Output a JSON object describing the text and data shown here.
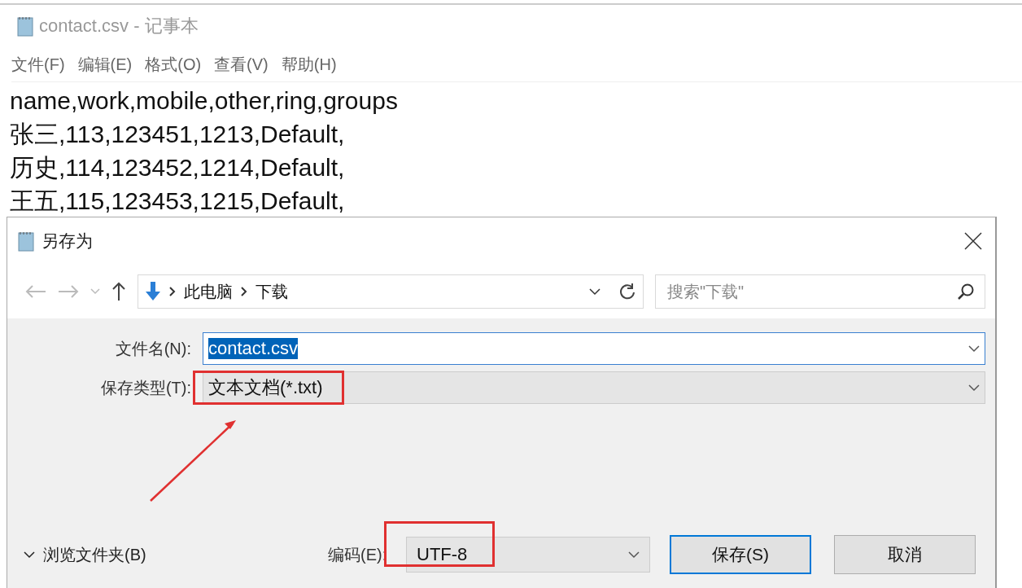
{
  "notepad": {
    "title": "contact.csv - 记事本",
    "menu": [
      "文件(F)",
      "编辑(E)",
      "格式(O)",
      "查看(V)",
      "帮助(H)"
    ],
    "lines": [
      "name,work,mobile,other,ring,groups",
      "张三,113,123451,1213,Default,",
      "历史,114,123452,1214,Default,",
      "王五,115,123453,1215,Default,"
    ]
  },
  "dialog": {
    "title": "另存为",
    "breadcrumb": [
      "此电脑",
      "下载"
    ],
    "search": {
      "placeholder": "搜索\"下载\""
    },
    "filename": {
      "label": "文件名(N):",
      "value": "contact.csv",
      "selected": true
    },
    "filetype": {
      "label": "保存类型(T):",
      "value": "文本文档(*.txt)"
    },
    "browse": {
      "label": "浏览文件夹(B)"
    },
    "encoding": {
      "label": "编码(E):",
      "value": "UTF-8"
    },
    "buttons": [
      {
        "label": "保存(S)",
        "kind": "primary"
      },
      {
        "label": "取消",
        "kind": "normal"
      }
    ]
  }
}
